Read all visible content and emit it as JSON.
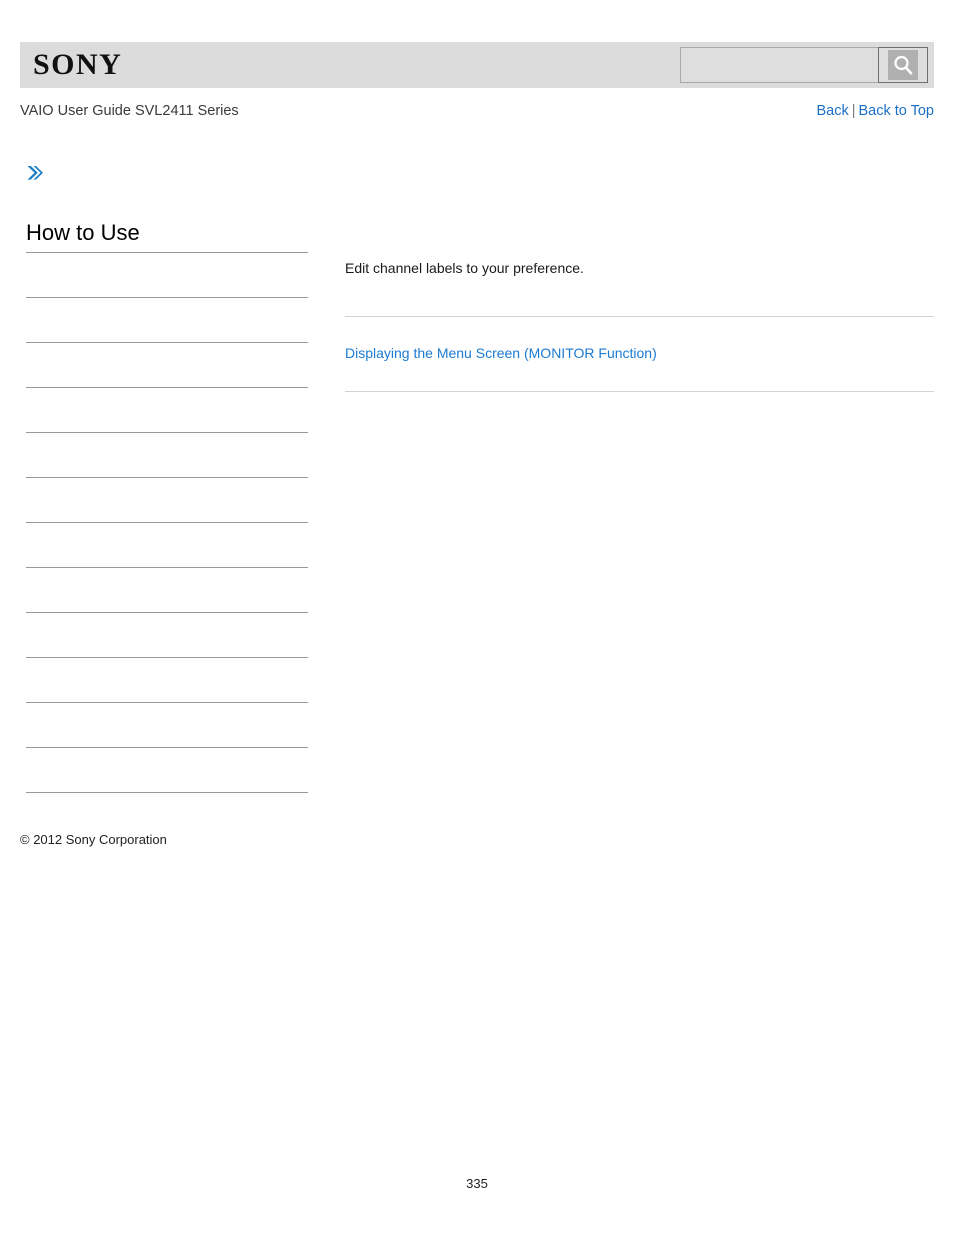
{
  "header": {
    "logo_text": "SONY",
    "search": {
      "value": "",
      "placeholder": "",
      "button_icon": "search-icon"
    }
  },
  "breadcrumb": {
    "title": "VAIO User Guide SVL2411 Series"
  },
  "nav": {
    "back_label": "Back",
    "separator": "|",
    "back_to_top_label": "Back to Top"
  },
  "icons": {
    "chevron": "double-chevron-right-icon"
  },
  "sidebar": {
    "title": "How to Use",
    "items": [
      {
        "label": ""
      },
      {
        "label": ""
      },
      {
        "label": ""
      },
      {
        "label": ""
      },
      {
        "label": ""
      },
      {
        "label": ""
      },
      {
        "label": ""
      },
      {
        "label": ""
      },
      {
        "label": ""
      },
      {
        "label": ""
      },
      {
        "label": ""
      },
      {
        "label": ""
      }
    ],
    "copyright": "© 2012 Sony Corporation"
  },
  "main": {
    "intro": "Edit channel labels to your preference.",
    "related_link": "Displaying the Menu Screen (MONITOR Function)"
  },
  "footer": {
    "page_number": "335"
  },
  "colors": {
    "header_bg": "#dcdcdc",
    "link_blue": "#1b7ad1",
    "nav_blue": "#1b6fc4",
    "chevron_blue": "#1f7ec4",
    "sidebar_rule": "#9a9a9a",
    "main_rule": "#d2d2d2"
  }
}
